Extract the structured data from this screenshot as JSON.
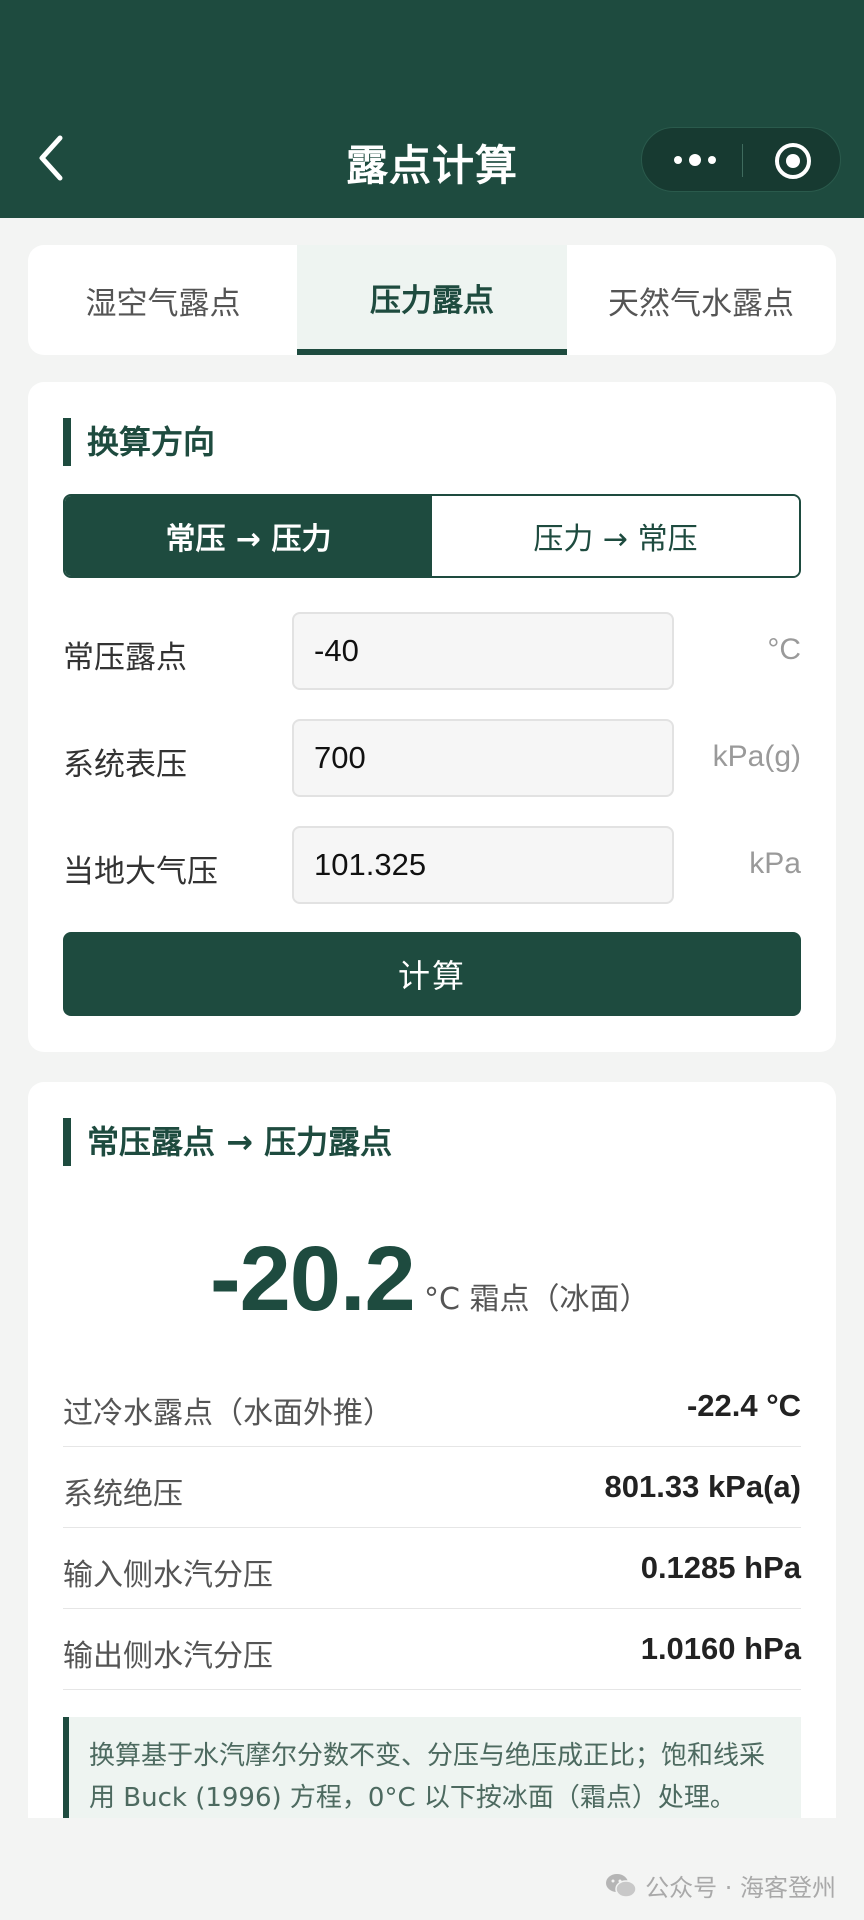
{
  "header": {
    "title": "露点计算"
  },
  "tabs": [
    {
      "label": "湿空气露点",
      "active": false
    },
    {
      "label": "压力露点",
      "active": true
    },
    {
      "label": "天然气水露点",
      "active": false
    }
  ],
  "direction": {
    "title": "换算方向",
    "option_on": "常压 → 压力",
    "option_off": "压力 → 常压"
  },
  "fields": [
    {
      "label": "常压露点",
      "value": "-40",
      "unit": "°C"
    },
    {
      "label": "系统表压",
      "value": "700",
      "unit": "kPa(g)"
    },
    {
      "label": "当地大气压",
      "value": "101.325",
      "unit": "kPa"
    }
  ],
  "calc_button": "计算",
  "result": {
    "title": "常压露点 → 压力露点",
    "value": "-20.2",
    "unit": "°C 霜点（冰面）",
    "rows": [
      {
        "k": "过冷水露点（水面外推）",
        "v": "-22.4 °C"
      },
      {
        "k": "系统绝压",
        "v": "801.33 kPa(a)"
      },
      {
        "k": "输入侧水汽分压",
        "v": "0.1285 hPa"
      },
      {
        "k": "输出侧水汽分压",
        "v": "1.0160 hPa"
      }
    ],
    "note": "换算基于水汽摩尔分数不变、分压与绝压成正比；饱和线采用 Buck (1996) 方程，0°C 以下按冰面（霜点）处理。"
  },
  "watermark": "公众号 · 海客登州",
  "colors": {
    "primary": "#1e4b3f",
    "background": "#f3f4f3"
  }
}
